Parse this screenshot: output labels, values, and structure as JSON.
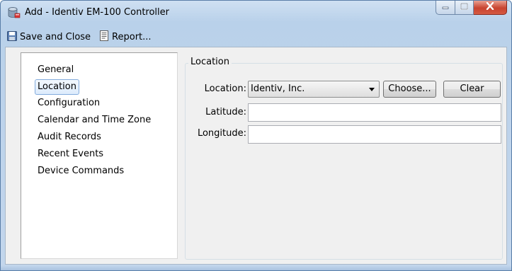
{
  "window": {
    "title": "Add - Identiv EM-100 Controller",
    "icon": "database-icon"
  },
  "toolbar": {
    "save_label": "Save and Close",
    "save_icon": "save-disk-icon",
    "report_label": "Report...",
    "report_icon": "report-icon"
  },
  "nav": {
    "items": [
      {
        "label": "General"
      },
      {
        "label": "Location",
        "selected": true
      },
      {
        "label": "Configuration"
      },
      {
        "label": "Calendar and Time Zone"
      },
      {
        "label": "Audit Records"
      },
      {
        "label": "Recent Events"
      },
      {
        "label": "Device Commands"
      }
    ]
  },
  "location_section": {
    "title": "Location",
    "location_label": "Location:",
    "location_value": "Identiv, Inc.",
    "choose_label": "Choose...",
    "clear_label": "Clear",
    "latitude_label": "Latitude:",
    "latitude_value": "",
    "longitude_label": "Longitude:",
    "longitude_value": ""
  },
  "colors": {
    "frame": "#c3d6ec",
    "close_button": "#c8432f",
    "selected_item_border": "#84acdd"
  }
}
